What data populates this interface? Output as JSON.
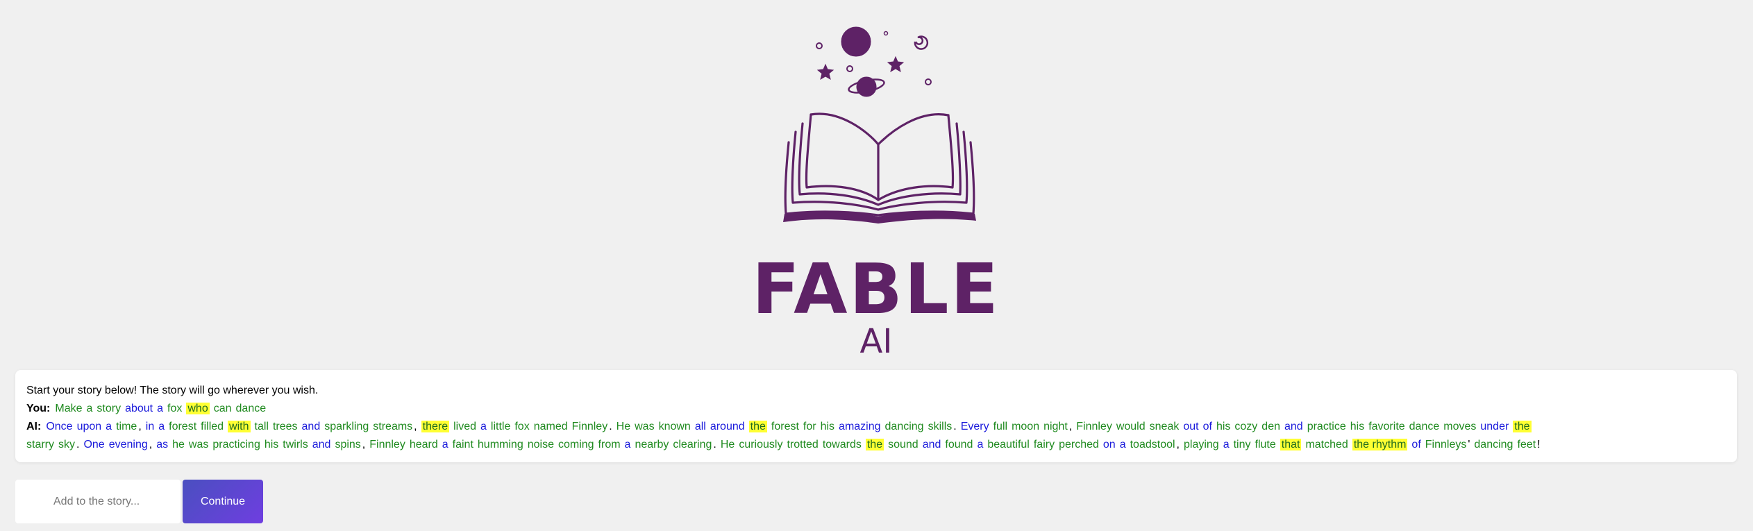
{
  "brand": {
    "logo_icon": "open-book-with-planets-icon",
    "title": "FABLE",
    "subtitle": "AI",
    "color": "#5e2266"
  },
  "story": {
    "intro": "Start your story below! The story will go wherever you wish.",
    "you_label": "You:",
    "ai_label": "AI:",
    "you_tokens": [
      [
        "Make",
        "g"
      ],
      [
        "a",
        "g"
      ],
      [
        "story",
        "g"
      ],
      [
        "about",
        "b"
      ],
      [
        "a",
        "b"
      ],
      [
        "fox",
        "g"
      ],
      [
        "who",
        "h"
      ],
      [
        "can",
        "g"
      ],
      [
        "dance",
        "g"
      ]
    ],
    "ai_line1": [
      [
        "Once",
        "b"
      ],
      [
        "upon",
        "b"
      ],
      [
        "a",
        "b"
      ],
      [
        "time",
        "g"
      ],
      [
        ",",
        "p"
      ],
      [
        "in",
        "b"
      ],
      [
        "a",
        "b"
      ],
      [
        "forest",
        "g"
      ],
      [
        "filled",
        "g"
      ],
      [
        "with",
        "h"
      ],
      [
        "tall",
        "g"
      ],
      [
        "trees",
        "g"
      ],
      [
        "and",
        "b"
      ],
      [
        "sparkling",
        "g"
      ],
      [
        "streams",
        "g"
      ],
      [
        ",",
        "p"
      ],
      [
        "there",
        "h"
      ],
      [
        "lived",
        "g"
      ],
      [
        "a",
        "b"
      ],
      [
        "little",
        "g"
      ],
      [
        "fox",
        "g"
      ],
      [
        "named",
        "g"
      ],
      [
        "Finnley",
        "g"
      ],
      [
        ".",
        "p"
      ],
      [
        "He",
        "g"
      ],
      [
        "was",
        "g"
      ],
      [
        "known",
        "g"
      ],
      [
        "all",
        "b"
      ],
      [
        "around",
        "b"
      ],
      [
        "the",
        "h"
      ],
      [
        "forest",
        "g"
      ],
      [
        "for",
        "g"
      ],
      [
        "his",
        "g"
      ],
      [
        "amazing",
        "b"
      ],
      [
        "dancing",
        "g"
      ],
      [
        "skills",
        "g"
      ],
      [
        ".",
        "p"
      ],
      [
        "Every",
        "b"
      ],
      [
        "full",
        "g"
      ],
      [
        "moon",
        "g"
      ],
      [
        "night",
        "g"
      ],
      [
        ",",
        "p"
      ],
      [
        "Finnley",
        "g"
      ],
      [
        "would",
        "g"
      ],
      [
        "sneak",
        "g"
      ],
      [
        "out",
        "b"
      ],
      [
        "of",
        "b"
      ],
      [
        "his",
        "g"
      ],
      [
        "cozy",
        "g"
      ],
      [
        "den",
        "g"
      ],
      [
        "and",
        "b"
      ],
      [
        "practice",
        "g"
      ],
      [
        "his",
        "g"
      ],
      [
        "favorite",
        "g"
      ],
      [
        "dance",
        "g"
      ],
      [
        "moves",
        "g"
      ],
      [
        "under",
        "b"
      ],
      [
        "the",
        "h"
      ]
    ],
    "ai_line2": [
      [
        "starry",
        "g"
      ],
      [
        "sky",
        "g"
      ],
      [
        ".",
        "p"
      ],
      [
        "One",
        "b"
      ],
      [
        "evening",
        "b"
      ],
      [
        ",",
        "p"
      ],
      [
        "as",
        "b"
      ],
      [
        "he",
        "g"
      ],
      [
        "was",
        "g"
      ],
      [
        "practicing",
        "g"
      ],
      [
        "his",
        "g"
      ],
      [
        "twirls",
        "g"
      ],
      [
        "and",
        "b"
      ],
      [
        "spins",
        "g"
      ],
      [
        ",",
        "p"
      ],
      [
        "Finnley",
        "g"
      ],
      [
        "heard",
        "g"
      ],
      [
        "a",
        "b"
      ],
      [
        "faint",
        "g"
      ],
      [
        "humming",
        "g"
      ],
      [
        "noise",
        "g"
      ],
      [
        "coming",
        "g"
      ],
      [
        "from",
        "g"
      ],
      [
        "a",
        "b"
      ],
      [
        "nearby",
        "g"
      ],
      [
        "clearing",
        "g"
      ],
      [
        ".",
        "p"
      ],
      [
        "He",
        "g"
      ],
      [
        "curiously",
        "g"
      ],
      [
        "trotted",
        "g"
      ],
      [
        "towards",
        "g"
      ],
      [
        "the",
        "h"
      ],
      [
        "sound",
        "g"
      ],
      [
        "and",
        "b"
      ],
      [
        "found",
        "g"
      ],
      [
        "a",
        "b"
      ],
      [
        "beautiful",
        "g"
      ],
      [
        "fairy",
        "g"
      ],
      [
        "perched",
        "g"
      ],
      [
        "on",
        "b"
      ],
      [
        "a",
        "b"
      ],
      [
        "toadstool",
        "g"
      ],
      [
        ",",
        "p"
      ],
      [
        "playing",
        "g"
      ],
      [
        "a",
        "b"
      ],
      [
        "tiny",
        "g"
      ],
      [
        "flute",
        "g"
      ],
      [
        "that",
        "h"
      ],
      [
        "matched",
        "g"
      ],
      [
        "the rhythm",
        "h"
      ],
      [
        "of",
        "b"
      ],
      [
        "Finnleys",
        "g"
      ],
      [
        "'",
        "p"
      ],
      [
        "dancing",
        "g"
      ],
      [
        "feet",
        "g"
      ],
      [
        "!",
        "p"
      ]
    ]
  },
  "input": {
    "placeholder": "Add to the story..."
  },
  "actions": {
    "continue_label": "Continue"
  },
  "colors": {
    "green_token": "#1f8a1f",
    "blue_token": "#1a1adb",
    "highlight": "#ffff33",
    "button_gradient_start": "#4a4fc0",
    "button_gradient_end": "#6f3ee0"
  }
}
